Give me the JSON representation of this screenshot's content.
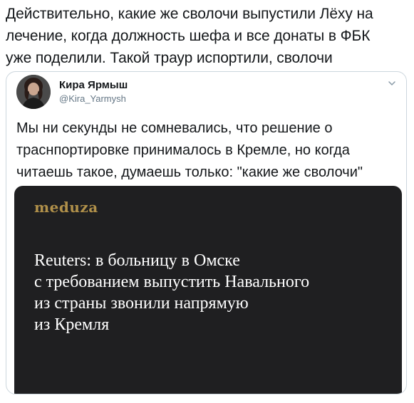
{
  "tweet": {
    "text_lines": [
      "Действительно, какие же сволочи выпустили Лёху на",
      "лечение, когда должность шефа и все донаты в ФБК",
      "уже поделили. Такой траур испортили, сволочи"
    ]
  },
  "quoted_tweet": {
    "author_name": "Кира Ярмыш",
    "author_handle": "@Kira_Yarmysh",
    "text_lines": [
      "Мы ни секунды не сомневались, что решение о",
      "траснпортировке принималось в Кремле, но когда",
      "читаешь такое, думаешь только: \"какие же сволочи\""
    ],
    "media": {
      "logo": "meduza",
      "headline_lines": [
        "Reuters: в больницу в Омске",
        "с требованием выпустить Навального",
        "из страны звонили напрямую",
        "из Кремля"
      ]
    }
  },
  "icons": {
    "caret": "chevron-down-icon",
    "avatar": "user-avatar"
  },
  "colors": {
    "text": "#14171a",
    "secondary_text": "#657786",
    "card_border": "#ccd6dd",
    "media_background": "#1f1f21",
    "logo_gold": "#b0904a"
  }
}
